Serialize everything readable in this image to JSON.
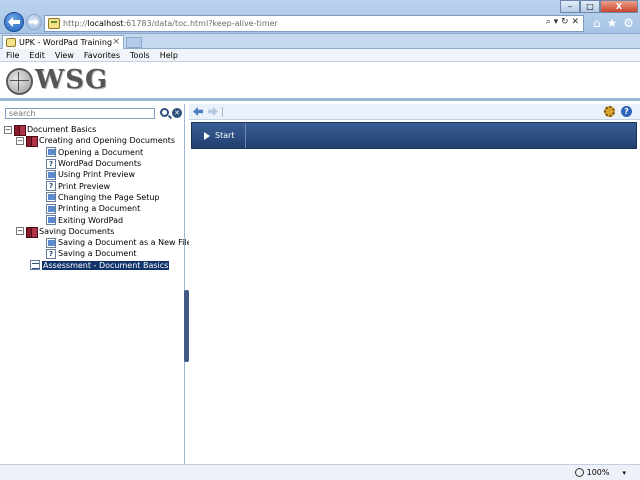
{
  "browser": {
    "address_host_prefix": "http://",
    "address_host": "localhost",
    "address_path": ":61783/data/toc.html?keep-alive-timer",
    "tab_title": "UPK - WordPad Training",
    "tab_close": "×",
    "menu": [
      "File",
      "Edit",
      "View",
      "Favorites",
      "Tools",
      "Help"
    ],
    "win_min": "–",
    "win_max": "□",
    "win_close": "X",
    "home_glyph": "⌂",
    "star_glyph": "★",
    "gear_glyph": "⚙",
    "addr_tools": "⌕ ▾ ↻ ✕"
  },
  "banner": {
    "logo_text": "WSG"
  },
  "toc": {
    "search_placeholder": "search",
    "clear_glyph": "✕",
    "items": [
      {
        "label": "Document Basics",
        "level": 0,
        "kind": "book",
        "expander": "−"
      },
      {
        "label": "Creating and Opening Documents",
        "level": 1,
        "kind": "book",
        "expander": "−"
      },
      {
        "label": "Opening a Document",
        "level": 2,
        "kind": "topic"
      },
      {
        "label": "WordPad Documents",
        "level": 2,
        "kind": "help"
      },
      {
        "label": "Using Print Preview",
        "level": 2,
        "kind": "topic"
      },
      {
        "label": "Print Preview",
        "level": 2,
        "kind": "help"
      },
      {
        "label": "Changing the Page Setup",
        "level": 2,
        "kind": "topic"
      },
      {
        "label": "Printing a Document",
        "level": 2,
        "kind": "topic"
      },
      {
        "label": "Exiting WordPad",
        "level": 2,
        "kind": "topic"
      },
      {
        "label": "Saving Documents",
        "level": 1,
        "kind": "book",
        "expander": "−"
      },
      {
        "label": "Saving a Document as a New File",
        "level": 2,
        "kind": "topic"
      },
      {
        "label": "Saving a Document",
        "level": 2,
        "kind": "help"
      },
      {
        "label": "Assessment - Document Basics",
        "level": 1,
        "kind": "assess",
        "selected": true
      }
    ]
  },
  "content": {
    "help_glyph": "?",
    "start_label": "Start"
  },
  "status": {
    "zoom": "100%",
    "zoom_caret": "▾"
  }
}
